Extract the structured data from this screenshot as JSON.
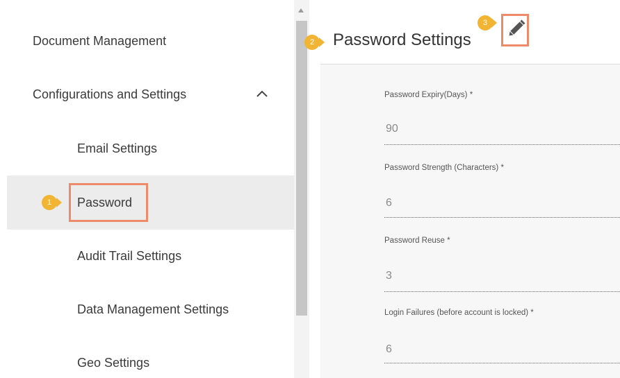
{
  "sidebar": {
    "document_management": "Document Management",
    "configurations": "Configurations and Settings",
    "items": [
      {
        "label": "Email Settings"
      },
      {
        "label": "Password"
      },
      {
        "label": "Audit Trail Settings"
      },
      {
        "label": "Data Management Settings"
      },
      {
        "label": "Geo Settings"
      }
    ]
  },
  "header": {
    "title": "Password Settings"
  },
  "callouts": {
    "one": "1",
    "two": "2",
    "three": "3"
  },
  "fields": [
    {
      "label": "Password Expiry(Days) *",
      "value": "90"
    },
    {
      "label": "Password Strength (Characters) *",
      "value": "6"
    },
    {
      "label": "Password Reuse *",
      "value": "3"
    },
    {
      "label": "Login Failures (before account is locked) *",
      "value": "6"
    }
  ],
  "colors": {
    "highlight": "#ec8a69",
    "badge": "#f2b533",
    "active_row": "#ececec"
  },
  "icons": {
    "chevron": "chevron-up-icon",
    "edit": "pencil-icon"
  }
}
